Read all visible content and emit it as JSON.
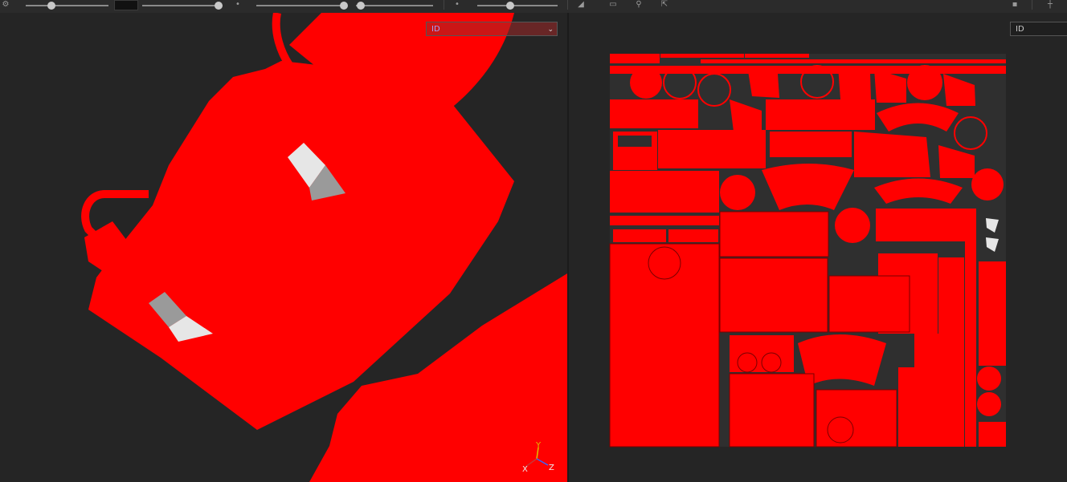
{
  "toolbar": {
    "icons": [
      "settings-icon",
      "brush-icon",
      "symmetry-icon",
      "layer-icon",
      "camera-icon",
      "share-icon",
      "grid-icon"
    ],
    "sliders": [
      {
        "name": "brush-size-slider",
        "value": 0.3
      },
      {
        "name": "brush-flow-slider",
        "value": 0.95
      },
      {
        "name": "brush-spacing-slider",
        "value": 0.5
      },
      {
        "name": "brush-hardness-slider",
        "value": 0.58
      },
      {
        "name": "view-slider",
        "value": 0.4
      }
    ],
    "brush_color": "#111111"
  },
  "viewport_3d": {
    "channel": "ID",
    "axis": {
      "x": "X",
      "y": "Y",
      "z": "Z"
    }
  },
  "viewport_2d": {
    "channel": "ID"
  },
  "colors": {
    "id_red": "#ff0000",
    "background": "#252525",
    "uv_background": "#2f2f2f",
    "white_patch": "#e6e6e6",
    "grey_patch": "#9a9a9a"
  }
}
